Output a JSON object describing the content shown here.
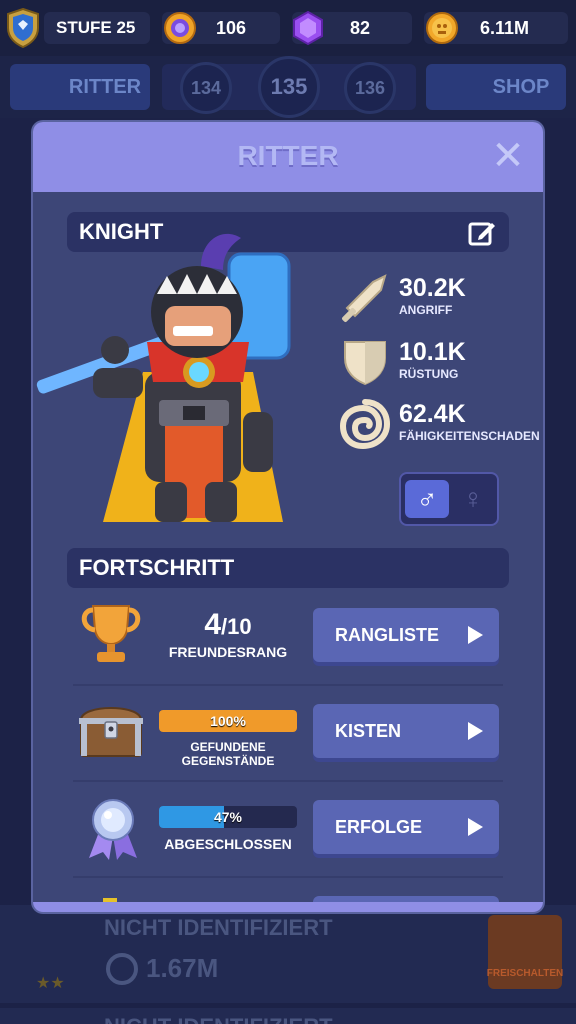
{
  "topbar": {
    "level_label": "STUFE 25",
    "gems": "106",
    "crystals": "82",
    "coins": "6.11M"
  },
  "background": {
    "tab_heroes": "RITTER",
    "tab_shop": "SHOP",
    "levels": [
      "134",
      "135",
      "136"
    ],
    "rows": [
      {
        "title": "NICHT IDENTIFIZIERT",
        "value": "1.67M",
        "button": "FREISCHALTEN"
      },
      {
        "title": "NICHT IDENTIFIZIERT"
      }
    ]
  },
  "modal": {
    "title": "RITTER",
    "hero": {
      "name": "KNIGHT",
      "stats": [
        {
          "value": "30.2K",
          "label": "ANGRIFF",
          "icon": "sword-icon"
        },
        {
          "value": "10.1K",
          "label": "RÜSTUNG",
          "icon": "shield-icon"
        },
        {
          "value": "62.4K",
          "label": "FÄHIGKEITENSCHADEN",
          "icon": "skill-swirl-icon"
        }
      ],
      "gender_male": "♂",
      "gender_female": "♀"
    },
    "progress": {
      "title": "FORTSCHRITT",
      "rows": [
        {
          "value": "4",
          "total": "/10",
          "caption": "FREUNDESRANG",
          "button": "RANGLISTE"
        },
        {
          "percent": "100%",
          "fill": 1.0,
          "caption": "GEFUNDENE GEGENSTÄNDE",
          "button": "KISTEN"
        },
        {
          "percent": "47%",
          "fill": 0.47,
          "caption": "ABGESCHLOSSEN",
          "button": "ERFOLGE"
        }
      ]
    }
  },
  "colors": {
    "accent": "#8f8ee6",
    "button": "#5a66b4",
    "progress_orange": "#f09a2a",
    "progress_blue": "#2f98e4"
  }
}
